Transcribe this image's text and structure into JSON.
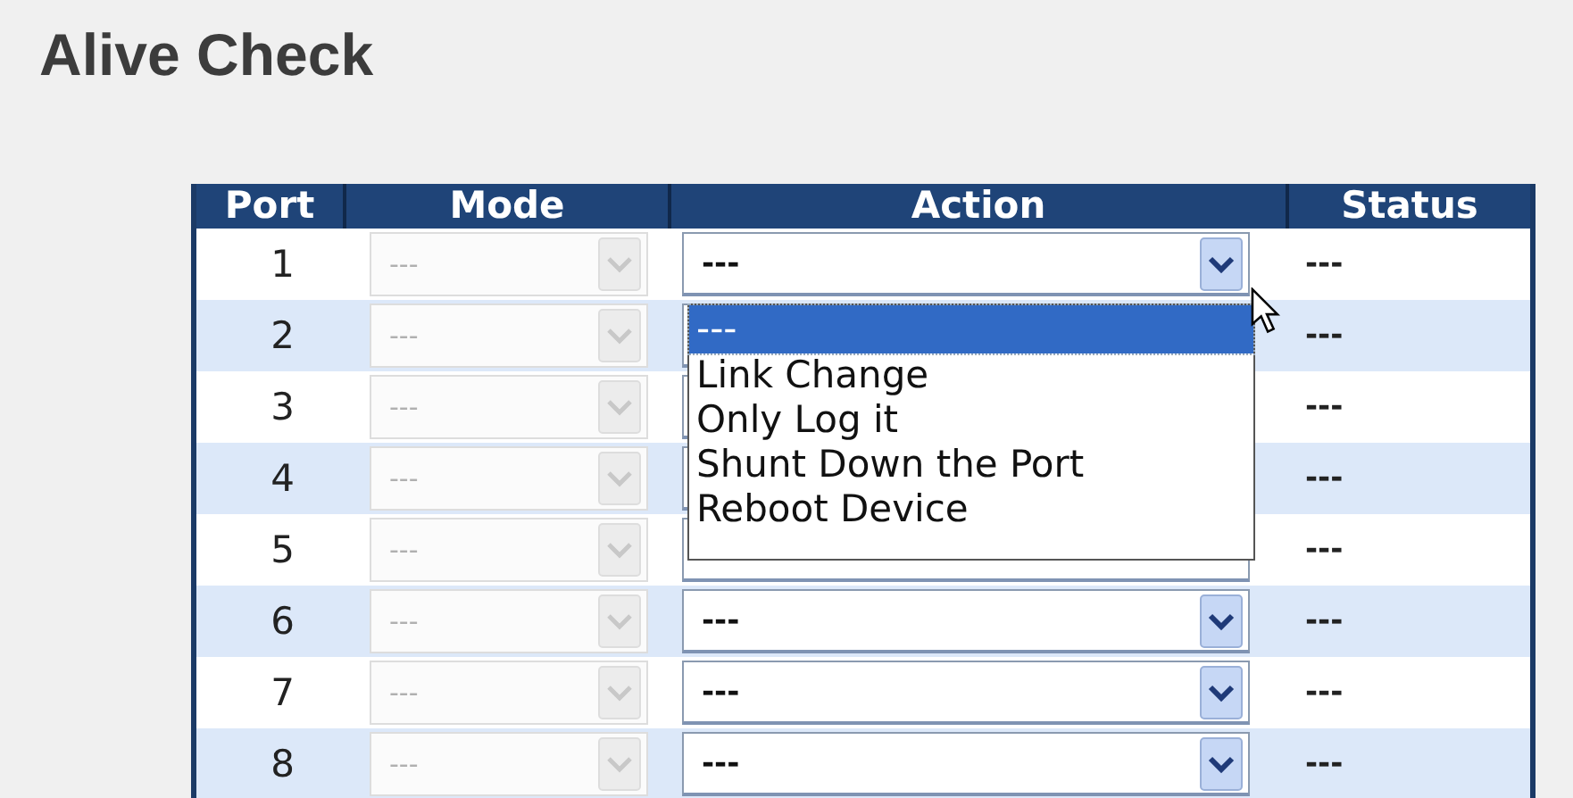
{
  "title": "Alive Check",
  "table": {
    "columns": [
      "Port",
      "Mode",
      "Action",
      "Status"
    ],
    "rows": [
      {
        "port": "1",
        "mode": {
          "value": "---",
          "disabled": true
        },
        "action": {
          "value": "---"
        },
        "status": "---"
      },
      {
        "port": "2",
        "mode": {
          "value": "---",
          "disabled": true
        },
        "status": "---"
      },
      {
        "port": "3",
        "mode": {
          "value": "---",
          "disabled": true
        },
        "status": "---"
      },
      {
        "port": "4",
        "mode": {
          "value": "---",
          "disabled": true
        },
        "status": "---"
      },
      {
        "port": "5",
        "mode": {
          "value": "---",
          "disabled": true
        },
        "status": "---"
      },
      {
        "port": "6",
        "mode": {
          "value": "---",
          "disabled": true
        },
        "action": {
          "value": "---"
        },
        "status": "---"
      },
      {
        "port": "7",
        "mode": {
          "value": "---",
          "disabled": true
        },
        "action": {
          "value": "---"
        },
        "status": "---"
      },
      {
        "port": "8",
        "mode": {
          "value": "---",
          "disabled": true
        },
        "action": {
          "value": "---"
        },
        "status": "---"
      }
    ]
  },
  "action_dropdown": {
    "options": [
      {
        "label": "---",
        "selected": true
      },
      {
        "label": "Link Change",
        "selected": false
      },
      {
        "label": "Only Log it",
        "selected": false
      },
      {
        "label": "Shunt Down the Port",
        "selected": false
      },
      {
        "label": "Reboot Device",
        "selected": false
      }
    ]
  }
}
